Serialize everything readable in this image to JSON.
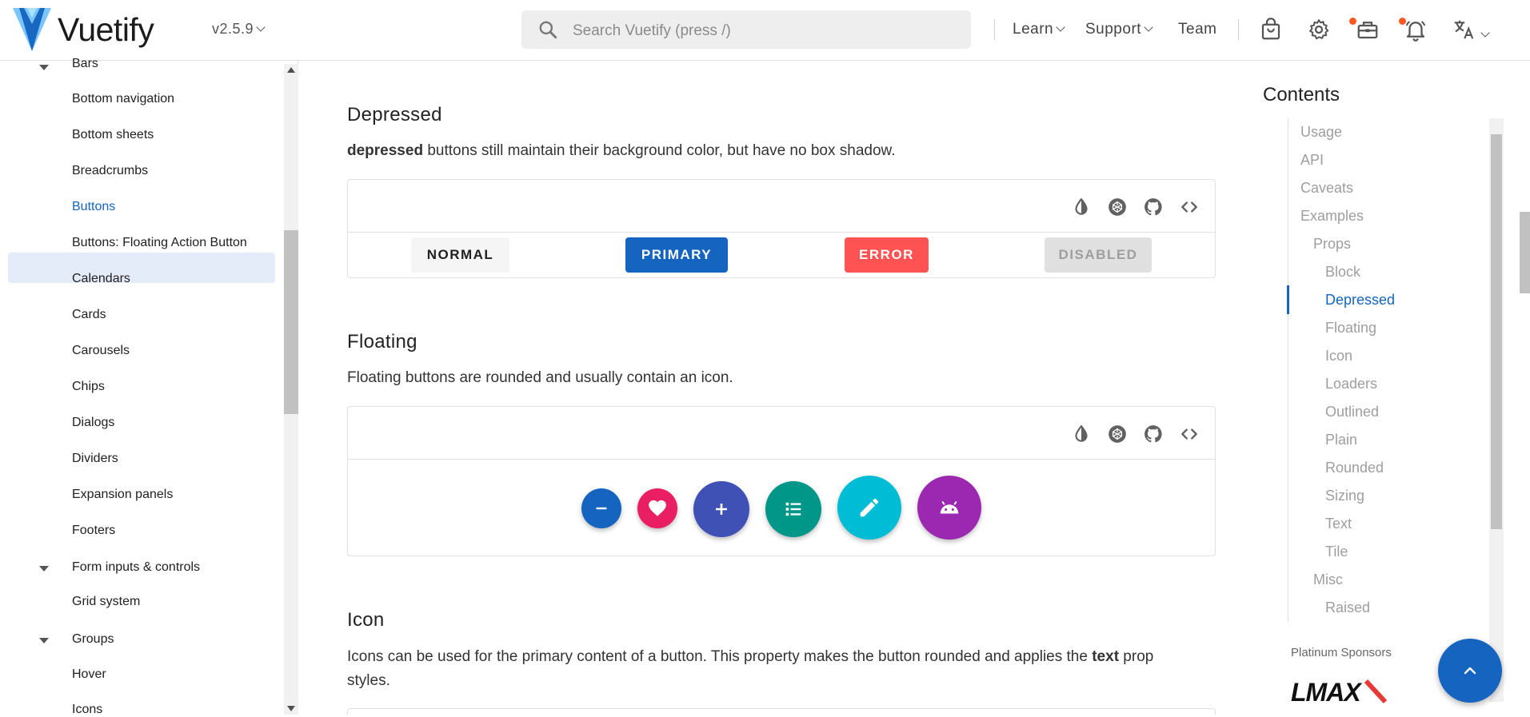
{
  "brand": {
    "name": "Vuetify",
    "version": "v2.5.9",
    "colors": {
      "primary": "#1565c0",
      "logo_light": "#7bc6ff",
      "logo_dark": "#1867c0"
    }
  },
  "search": {
    "placeholder": "Search Vuetify (press /)"
  },
  "header_nav": [
    {
      "label": "Learn",
      "has_dropdown": true
    },
    {
      "label": "Support",
      "has_dropdown": true
    },
    {
      "label": "Team",
      "has_dropdown": false
    }
  ],
  "header_icons": [
    "shopping-bag-icon",
    "settings-gear-icon",
    "toolbox-icon",
    "bell-icon",
    "translate-icon"
  ],
  "sidebar": {
    "items": [
      {
        "label": "Bars",
        "type": "group",
        "expanded": true
      },
      {
        "label": "Bottom navigation",
        "type": "item"
      },
      {
        "label": "Bottom sheets",
        "type": "item"
      },
      {
        "label": "Breadcrumbs",
        "type": "item"
      },
      {
        "label": "Buttons",
        "type": "item",
        "active": true
      },
      {
        "label": "Buttons: Floating Action Button",
        "type": "item"
      },
      {
        "label": "Calendars",
        "type": "item"
      },
      {
        "label": "Cards",
        "type": "item"
      },
      {
        "label": "Carousels",
        "type": "item"
      },
      {
        "label": "Chips",
        "type": "item"
      },
      {
        "label": "Dialogs",
        "type": "item"
      },
      {
        "label": "Dividers",
        "type": "item"
      },
      {
        "label": "Expansion panels",
        "type": "item"
      },
      {
        "label": "Footers",
        "type": "item"
      },
      {
        "label": "Form inputs & controls",
        "type": "group",
        "expanded": true
      },
      {
        "label": "Grid system",
        "type": "item"
      },
      {
        "label": "Groups",
        "type": "group",
        "expanded": true
      },
      {
        "label": "Hover",
        "type": "item"
      },
      {
        "label": "Icons",
        "type": "item"
      }
    ]
  },
  "sections": {
    "depressed": {
      "title": "Depressed",
      "desc_bold": "depressed",
      "desc_rest": " buttons still maintain their background color, but have no box shadow.",
      "buttons": [
        {
          "label": "NORMAL",
          "color": "#f5f5f5",
          "text_color": "#212121"
        },
        {
          "label": "PRIMARY",
          "color": "#1565c0",
          "text_color": "#ffffff"
        },
        {
          "label": "ERROR",
          "color": "#ff5252",
          "text_color": "#ffffff"
        },
        {
          "label": "DISABLED",
          "color": "#e0e0e0",
          "text_color": "#9e9e9e",
          "disabled": true
        }
      ]
    },
    "floating": {
      "title": "Floating",
      "desc": "Floating buttons are rounded and usually contain an icon.",
      "fabs": [
        {
          "icon": "minus-icon",
          "color": "#1565c0",
          "size": "small"
        },
        {
          "icon": "heart-icon",
          "color": "#e91e63",
          "size": "small"
        },
        {
          "icon": "plus-icon",
          "color": "#3f51b5",
          "size": "default"
        },
        {
          "icon": "format-list-icon",
          "color": "#009688",
          "size": "default"
        },
        {
          "icon": "pencil-icon",
          "color": "#00bcd4",
          "size": "large"
        },
        {
          "icon": "android-icon",
          "color": "#9c27b0",
          "size": "large"
        }
      ]
    },
    "icon": {
      "title": "Icon",
      "desc_before": "Icons can be used for the primary content of a button. This property makes the button rounded and applies the ",
      "desc_bold": "text",
      "desc_after": " prop",
      "desc_line2": "styles."
    }
  },
  "demo_toolbar_icons": [
    "invert-colors-icon",
    "codepen-icon",
    "github-icon",
    "code-icon"
  ],
  "toc": {
    "title": "Contents",
    "items": [
      {
        "label": "Usage",
        "level": 0
      },
      {
        "label": "API",
        "level": 0
      },
      {
        "label": "Caveats",
        "level": 0
      },
      {
        "label": "Examples",
        "level": 0
      },
      {
        "label": "Props",
        "level": 1
      },
      {
        "label": "Block",
        "level": 2
      },
      {
        "label": "Depressed",
        "level": 2,
        "active": true
      },
      {
        "label": "Floating",
        "level": 2
      },
      {
        "label": "Icon",
        "level": 2
      },
      {
        "label": "Loaders",
        "level": 2
      },
      {
        "label": "Outlined",
        "level": 2
      },
      {
        "label": "Plain",
        "level": 2
      },
      {
        "label": "Rounded",
        "level": 2
      },
      {
        "label": "Sizing",
        "level": 2
      },
      {
        "label": "Text",
        "level": 2
      },
      {
        "label": "Tile",
        "level": 2
      },
      {
        "label": "Misc",
        "level": 1
      },
      {
        "label": "Raised",
        "level": 2
      }
    ],
    "sponsor_label": "Platinum Sponsors",
    "sponsor_name": "LMAX"
  }
}
